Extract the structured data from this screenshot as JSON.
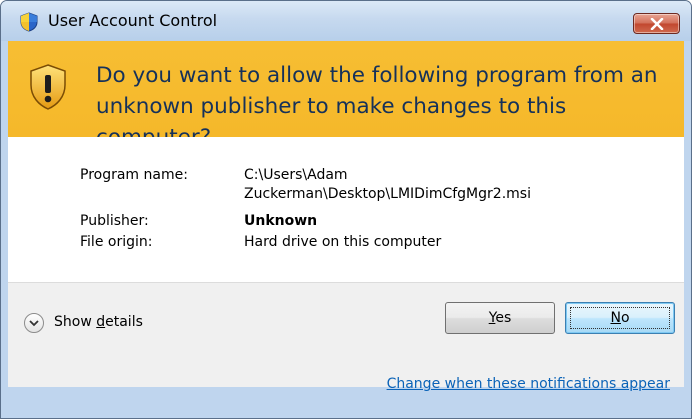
{
  "window": {
    "title": "User Account Control"
  },
  "banner": {
    "question": "Do you want to allow the following program from an unknown publisher to make changes to this computer?"
  },
  "details": {
    "program_name_label": "Program name:",
    "program_name_line1": "C:\\Users\\Adam",
    "program_name_line2": "Zuckerman\\Desktop\\LMIDimCfgMgr2.msi",
    "publisher_label": "Publisher:",
    "publisher_value": "Unknown",
    "file_origin_label": "File origin:",
    "file_origin_value": "Hard drive on this computer"
  },
  "footer": {
    "show_details_pre": "Show ",
    "show_details_mnemonic": "d",
    "show_details_post": "etails",
    "yes_mnemonic": "Y",
    "yes_rest": "es",
    "no_mnemonic": "N",
    "no_rest": "o",
    "change_link": "Change when these notifications appear"
  },
  "icons": {
    "title_icon": "uac-shield-icon",
    "banner_icon": "warning-shield-icon",
    "close_icon": "close-icon",
    "chevron_icon": "chevron-down-icon"
  },
  "colors": {
    "banner": "#f5b82a",
    "question_text": "#15315a",
    "link": "#0b63b8",
    "close_button": "#c2472f"
  }
}
